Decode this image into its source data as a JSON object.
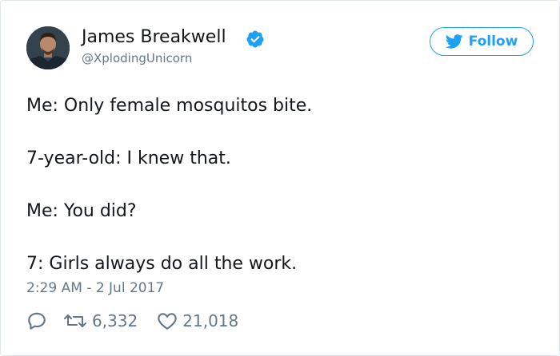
{
  "user": {
    "display_name": "James Breakwell",
    "handle": "@XplodingUnicorn",
    "verified": true
  },
  "follow_button": {
    "label": "Follow"
  },
  "tweet": {
    "lines": [
      "Me: Only female mosquitos bite.",
      "7-year-old: I knew that.",
      "Me: You did?",
      "7: Girls always do all the work."
    ],
    "timestamp": "2:29 AM - 2 Jul 2017"
  },
  "actions": {
    "retweets": "6,332",
    "likes": "21,018"
  },
  "colors": {
    "accent": "#1da1f2",
    "muted": "#657786",
    "text": "#14171a"
  },
  "icons": [
    "verified-badge-icon",
    "twitter-bird-icon",
    "reply-icon",
    "retweet-icon",
    "heart-icon"
  ]
}
